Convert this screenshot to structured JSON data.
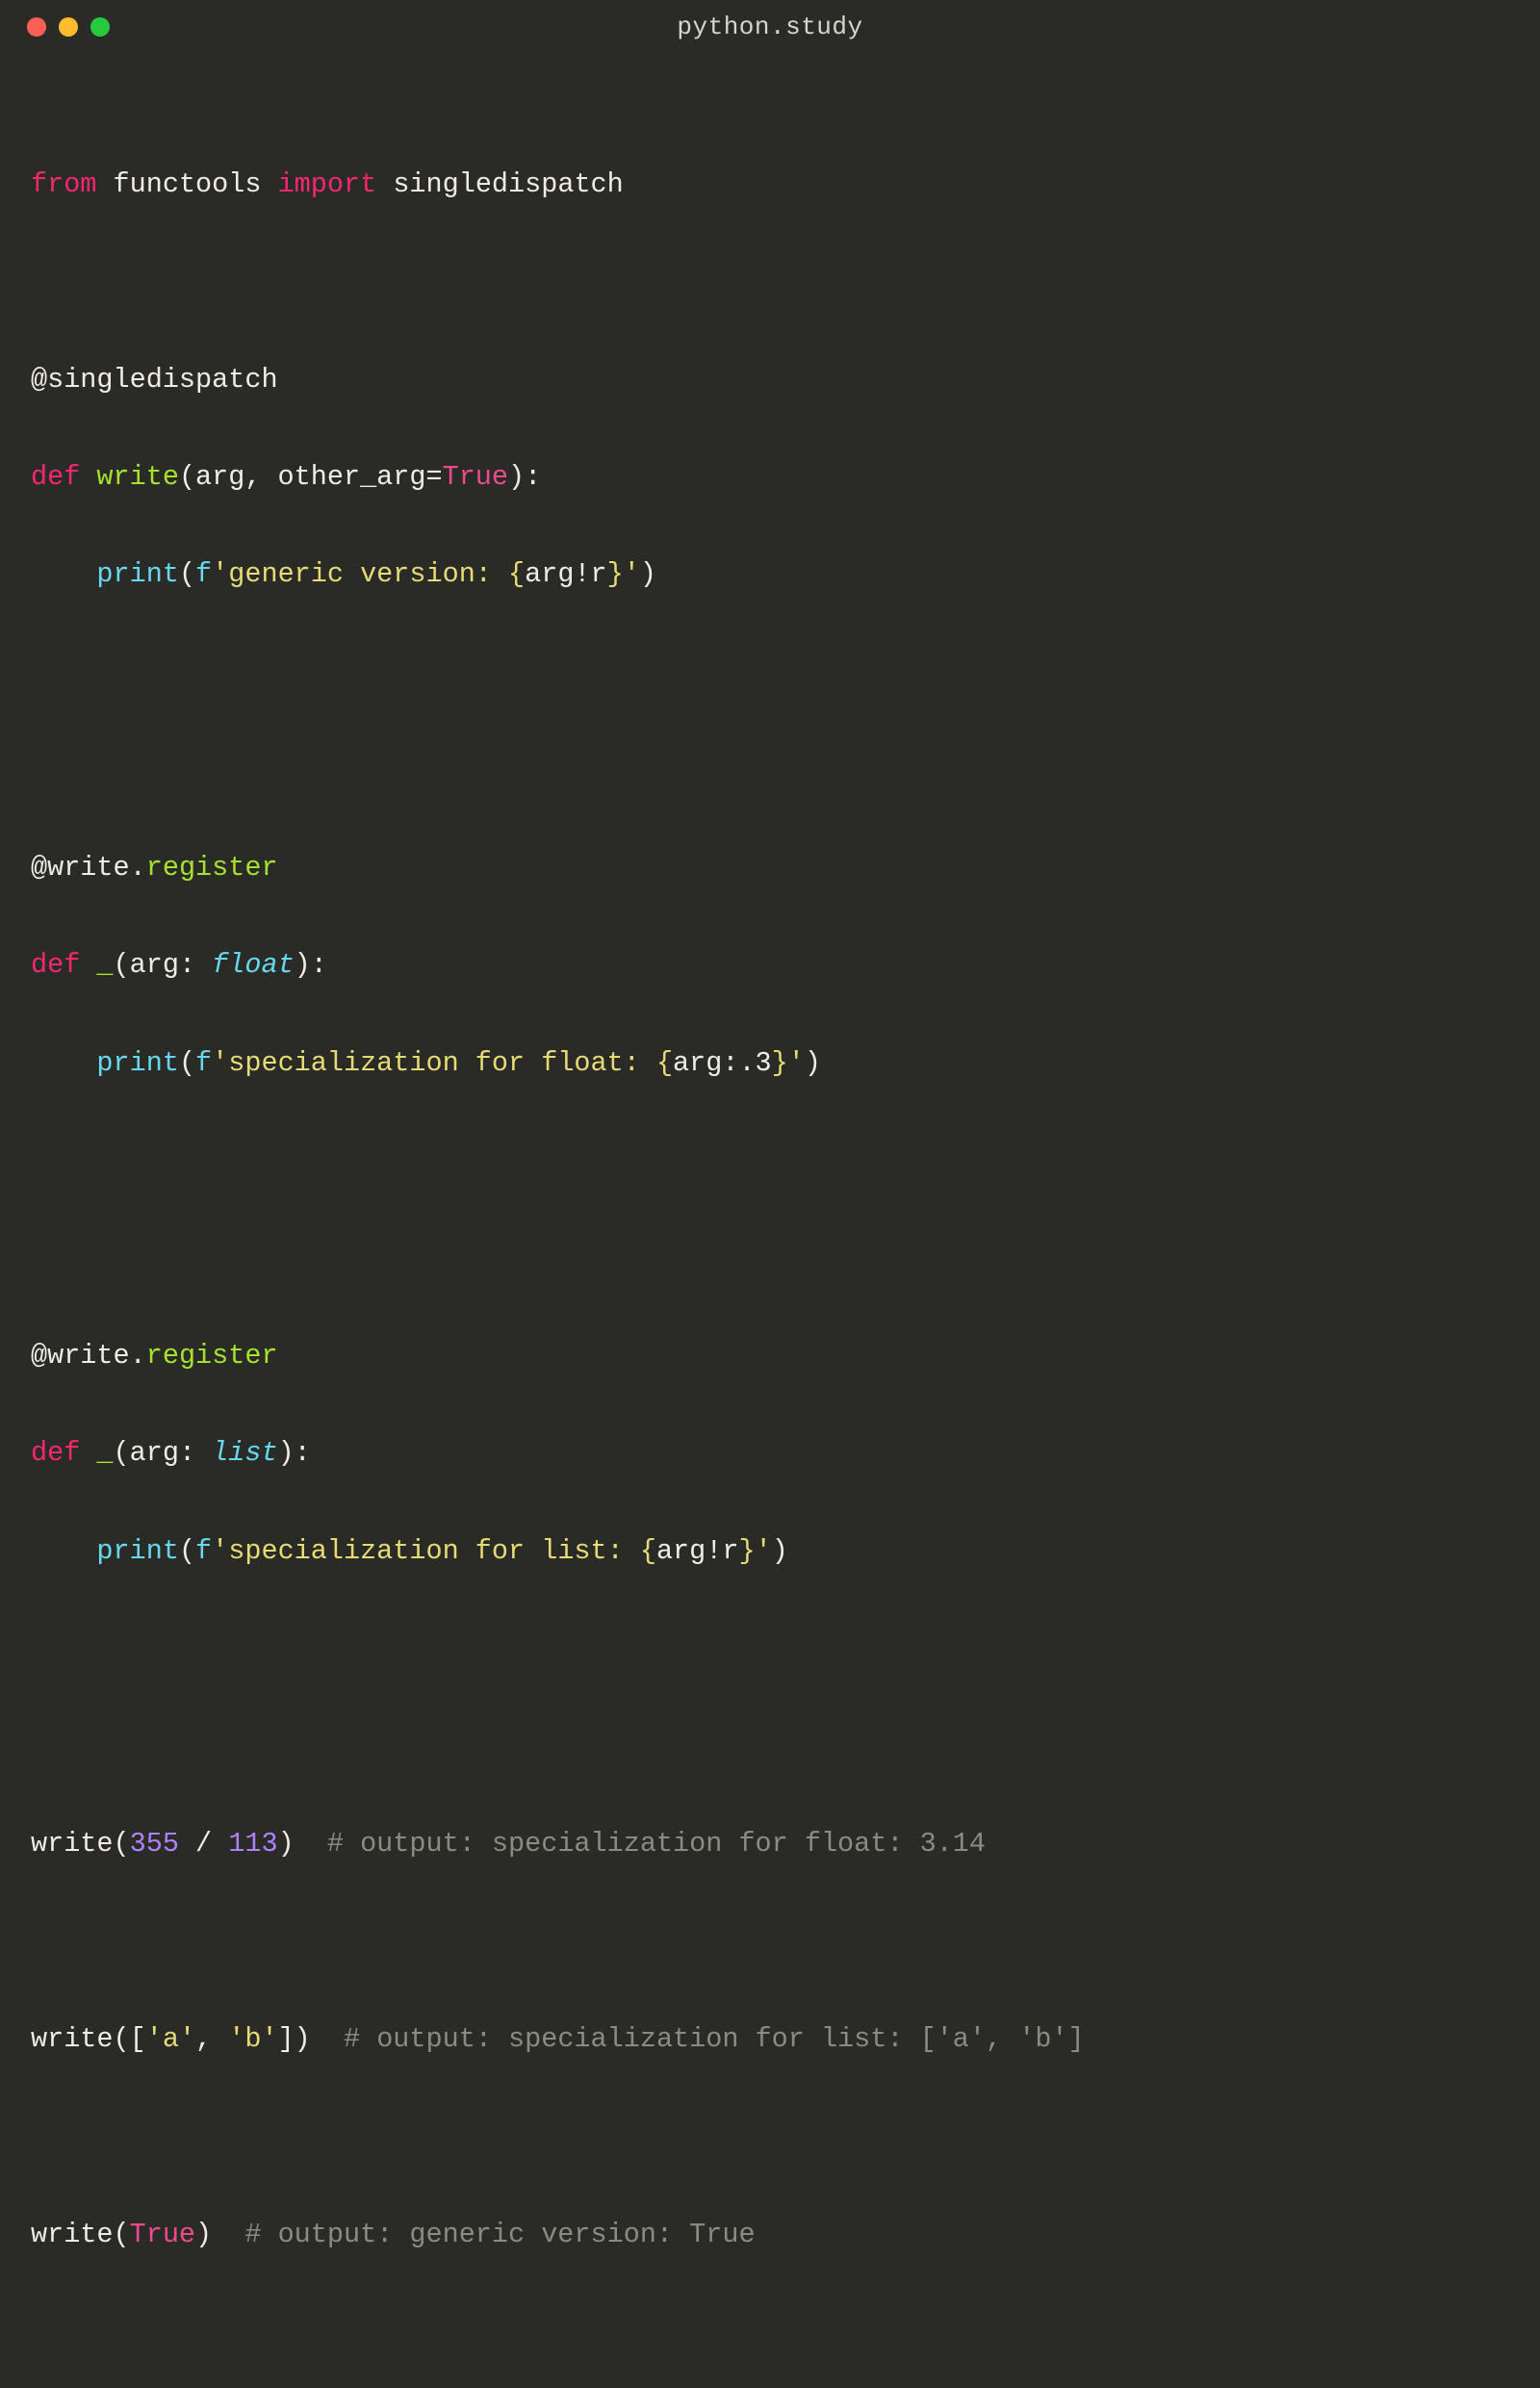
{
  "window": {
    "title": "python.study"
  },
  "colors": {
    "background": "#2a2a26",
    "keyword": "#f92672",
    "function": "#a6e22e",
    "type": "#66d9ef",
    "string": "#e6db74",
    "number": "#ae81ff",
    "constant": "#ec4a8e",
    "comment": "#8b8b80",
    "parameter": "#fd971f",
    "plain": "#f0ece4"
  },
  "code": {
    "l1": {
      "from": "from",
      "mod": "functools",
      "imp": "import",
      "name": "singledispatch"
    },
    "l3": {
      "at": "@singledispatch"
    },
    "l4": {
      "def": "def",
      "fn": "write",
      "open": "(arg, other_arg=",
      "true": "True",
      "close": "):"
    },
    "l5": {
      "indent": "    ",
      "print": "print",
      "open": "(",
      "f": "f",
      "s1": "'generic version: ",
      "lb": "{",
      "arg": "arg!r",
      "rb": "}",
      "s2": "'",
      "close": ")"
    },
    "l8": {
      "at": "@write",
      "dot": ".",
      "reg": "register"
    },
    "l9": {
      "def": "def",
      "fn": "_",
      "open": "(arg: ",
      "type": "float",
      "close": "):"
    },
    "l10": {
      "indent": "    ",
      "print": "print",
      "open": "(",
      "f": "f",
      "s1": "'specialization for float: ",
      "lb": "{",
      "arg": "arg:.3",
      "rb": "}",
      "s2": "'",
      "close": ")"
    },
    "l13": {
      "at": "@write",
      "dot": ".",
      "reg": "register"
    },
    "l14": {
      "def": "def",
      "fn": "_",
      "open": "(arg: ",
      "type": "list",
      "close": "):"
    },
    "l15": {
      "indent": "    ",
      "print": "print",
      "open": "(",
      "f": "f",
      "s1": "'specialization for list: ",
      "lb": "{",
      "arg": "arg!r",
      "rb": "}",
      "s2": "'",
      "close": ")"
    },
    "l18": {
      "pre": "write(",
      "n1": "355",
      "op": " / ",
      "n2": "113",
      "post": ")  ",
      "cmt": "# output: specialization for float: 3.14"
    },
    "l20": {
      "pre": "write([",
      "s1": "'a'",
      "c": ", ",
      "s2": "'b'",
      "post": "])  ",
      "cmt": "# output: specialization for list: ['a', 'b']"
    },
    "l22": {
      "pre": "write(",
      "true": "True",
      "post": ")  ",
      "cmt": "# output: generic version: True"
    }
  }
}
